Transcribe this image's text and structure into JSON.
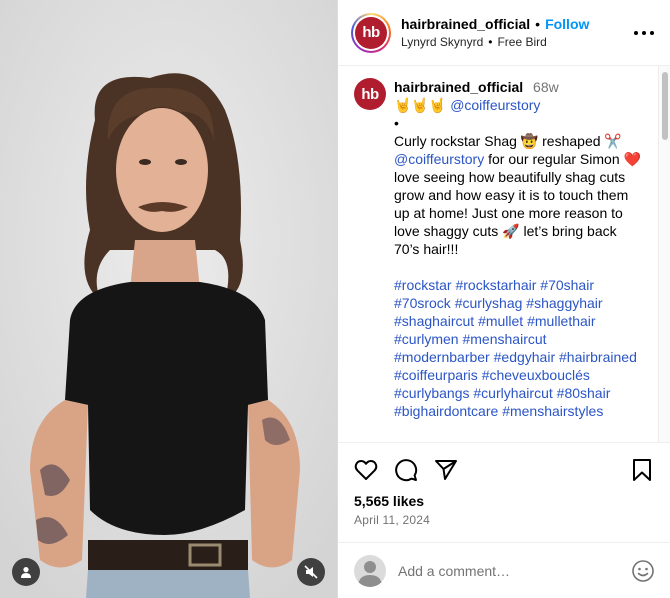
{
  "post": {
    "username": "hairbrained_official",
    "follow_label": "Follow",
    "audio_artist": "Lynyrd Skynyrd",
    "audio_title": "Free Bird",
    "avatar_text": "hb"
  },
  "caption": {
    "username": "hairbrained_official",
    "time_ago": "68w",
    "emoji_prefix": "🤘🤘🤘",
    "mention_top": "@coiffeurstory",
    "bullet": "•",
    "text_1": "Curly rockstar Shag 🤠 reshaped ✂️",
    "mention_inline": "@coiffeurstory",
    "text_2": "for our regular Simon ❤️ love seeing how beautifully shag cuts grow and how easy it is to touch them up at home! Just one more reason to love shaggy cuts 🚀 let’s bring back 70’s hair!!!",
    "hashtags": [
      "#rockstar",
      "#rockstarhair",
      "#70shair",
      "#70srock",
      "#curlyshag",
      "#shaggyhair",
      "#shaghaircut",
      "#mullet",
      "#mullethair",
      "#curlymen",
      "#menshaircut",
      "#modernbarber",
      "#edgyhair",
      "#hairbrained",
      "#coiffeurparis",
      "#cheveuxbouclés",
      "#curlybangs",
      "#curlyhaircut",
      "#80shair",
      "#bighairdontcare",
      "#menshairstyles"
    ]
  },
  "stats": {
    "likes": "5,565 likes",
    "date": "April 11, 2024"
  },
  "comment": {
    "placeholder": "Add a comment…"
  },
  "icons": {
    "like": "heart-icon",
    "comment": "comment-icon",
    "share": "send-icon",
    "save": "bookmark-icon",
    "emoji": "emoji-icon",
    "more": "more-icon",
    "tagged": "user-tag-icon",
    "mute": "mute-icon"
  }
}
